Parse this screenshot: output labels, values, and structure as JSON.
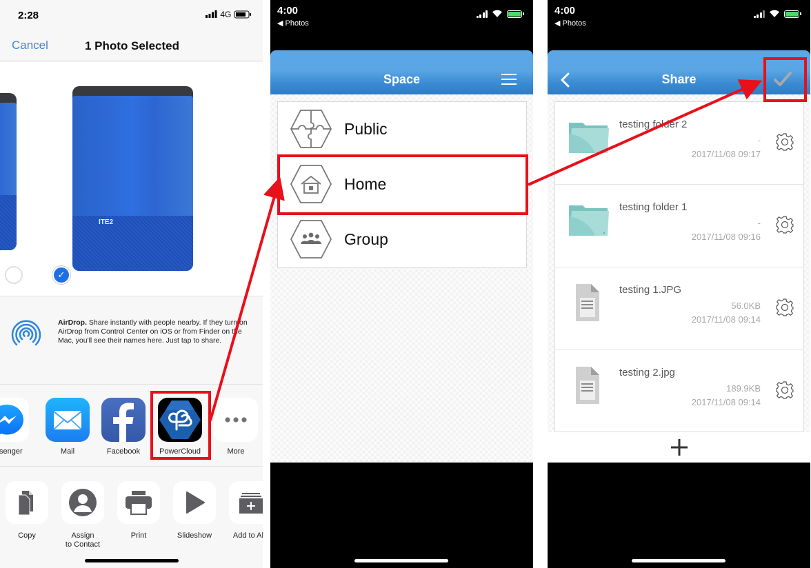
{
  "share_sheet": {
    "status": {
      "time": "2:28",
      "network": "4G"
    },
    "nav": {
      "cancel_label": "Cancel",
      "title": "1 Photo Selected"
    },
    "photos": [
      {
        "selected": false
      },
      {
        "selected": true,
        "logo_text": "ITE2"
      }
    ],
    "airdrop": {
      "title": "AirDrop.",
      "text": " Share instantly with people nearby. If they turn on AirDrop from Control Center on iOS or from Finder on the Mac, you'll see their names here. Just tap to share."
    },
    "apps": [
      {
        "label": "essenger",
        "icon": "messenger-icon"
      },
      {
        "label": "Mail",
        "icon": "mail-icon"
      },
      {
        "label": "Facebook",
        "icon": "facebook-icon"
      },
      {
        "label": "PowerCloud",
        "icon": "powercloud-icon"
      },
      {
        "label": "More",
        "icon": "more-icon"
      }
    ],
    "actions": [
      {
        "label": "Copy",
        "icon": "copy-icon"
      },
      {
        "label": "Assign\nto Contact",
        "icon": "contact-icon"
      },
      {
        "label": "Print",
        "icon": "print-icon"
      },
      {
        "label": "Slideshow",
        "icon": "play-icon"
      },
      {
        "label": "Add to Alb",
        "icon": "add-album-icon"
      }
    ]
  },
  "space_screen": {
    "status": {
      "time": "4:00",
      "back_app": "◀ Photos"
    },
    "title": "Space",
    "items": [
      {
        "label": "Public",
        "icon": "puzzle-icon"
      },
      {
        "label": "Home",
        "icon": "house-icon"
      },
      {
        "label": "Group",
        "icon": "group-icon"
      }
    ]
  },
  "share_screen": {
    "status": {
      "time": "4:00",
      "back_app": "◀ Photos"
    },
    "title": "Share",
    "files": [
      {
        "name": "testing folder 2",
        "type": "folder",
        "size": "-",
        "date": "2017/11/08 09:17"
      },
      {
        "name": "testing folder 1",
        "type": "folder",
        "size": "-",
        "date": "2017/11/08 09:16"
      },
      {
        "name": "testing 1.JPG",
        "type": "file",
        "size": "56.0KB",
        "date": "2017/11/08 09:14"
      },
      {
        "name": "testing 2.jpg",
        "type": "file",
        "size": "189.9KB",
        "date": "2017/11/08 09:14"
      }
    ]
  },
  "colors": {
    "ios_blue": "#3b88d9",
    "appbar_blue": "#4a98dc",
    "annotation_red": "#e8101a",
    "folder_teal": "#8fcfcc"
  }
}
